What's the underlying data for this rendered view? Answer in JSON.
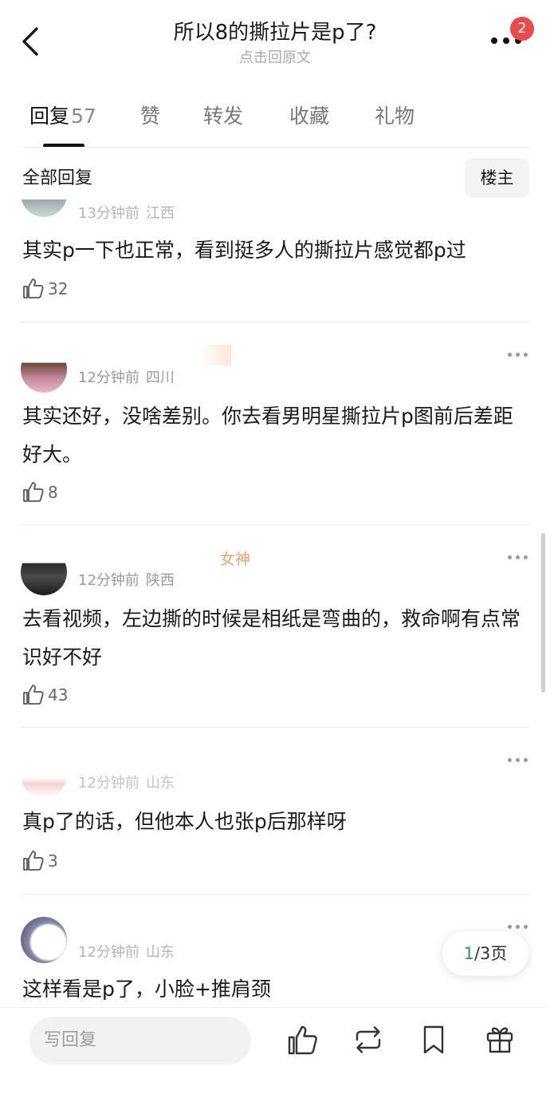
{
  "header": {
    "title": "所以8的撕拉片是p了?",
    "subtitle": "点击回原文",
    "badge": "2"
  },
  "tabs": [
    {
      "label": "回复",
      "count": "57"
    },
    {
      "label": "赞"
    },
    {
      "label": "转发"
    },
    {
      "label": "收藏"
    },
    {
      "label": "礼物"
    }
  ],
  "section": {
    "title": "全部回复",
    "filter": "楼主"
  },
  "comments": [
    {
      "time": "13分钟前",
      "location": "江西",
      "text": "其实p一下也正常，看到挺多人的撕拉片感觉都p过",
      "likes": "32"
    },
    {
      "time": "12分钟前",
      "location": "四川",
      "text": "其实还好，没啥差别。你去看男明星撕拉片p图前后差距好大。",
      "likes": "8"
    },
    {
      "username_fragment": "女神",
      "time": "12分钟前",
      "location": "陕西",
      "text": "去看视频，左边撕的时候是相纸是弯曲的，救命啊有点常识好不好",
      "likes": "43"
    },
    {
      "time": "12分钟前",
      "location": "山东",
      "text": "真p了的话，但他本人也张p后那样呀",
      "likes": "3"
    },
    {
      "time": "12分钟前",
      "location": "山东",
      "text": "这样看是p了，小脸+推肩颈"
    }
  ],
  "pagination": {
    "current": "1",
    "total_text": "/3页"
  },
  "bottom_bar": {
    "reply_placeholder": "写回复"
  },
  "colors": {
    "accent_green": "#2e9e45",
    "badge_red": "#f04848"
  },
  "icons": [
    "back-arrow-icon",
    "more-dots-icon",
    "thumb-up-icon",
    "repost-icon",
    "bookmark-icon",
    "gift-icon"
  ]
}
